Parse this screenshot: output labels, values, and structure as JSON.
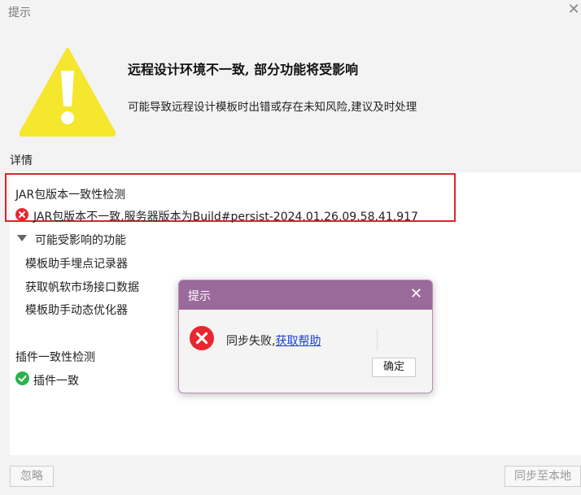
{
  "window": {
    "title": "提示"
  },
  "header": {
    "headline": "远程设计环境不一致, 部分功能将受影响",
    "subline": "可能导致远程设计模板时出错或存在未知风险,建议及时处理"
  },
  "details": {
    "label": "详情",
    "jar_check": {
      "title": "JAR包版本一致性检测",
      "error": "JAR包版本不一致,服务器版本为Build#persist-2024.01.26.09.58.41.917"
    },
    "affected": {
      "title": "可能受影响的功能",
      "items": [
        "模板助手埋点记录器",
        "获取帆软市场接口数据",
        "模板助手动态优化器"
      ]
    },
    "plugin_check": {
      "title": "插件一致性检测",
      "result": "插件一致"
    }
  },
  "footer": {
    "ignore_label": "忽略",
    "sync_label": "同步至本地"
  },
  "modal": {
    "title": "提示",
    "message": "同步失败,",
    "link_text": "获取帮助",
    "ok_label": "确定"
  },
  "colors": {
    "warning_yellow": "#f5e62e",
    "error_red": "#e8262f",
    "success_green": "#2bb24c",
    "modal_header": "#9b6a9c",
    "highlight_border": "#d9262b"
  }
}
